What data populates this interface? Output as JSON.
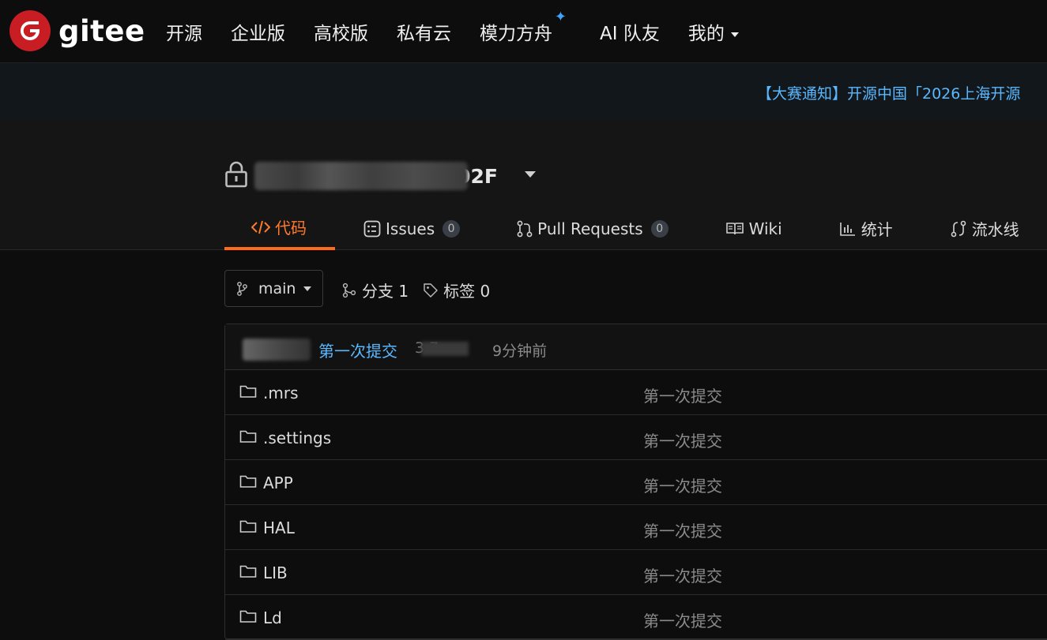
{
  "nav": {
    "logo_text": "gitee",
    "items": [
      "开源",
      "企业版",
      "高校版",
      "私有云",
      "模力方舟",
      "AI 队友",
      "我的"
    ]
  },
  "announcement": "【大赛通知】开源中国「2026上海开源",
  "repo": {
    "name_suffix": "02F",
    "tabs": [
      {
        "label": "代码"
      },
      {
        "label": "Issues",
        "count": "0"
      },
      {
        "label": "Pull Requests",
        "count": "0"
      },
      {
        "label": "Wiki"
      },
      {
        "label": "统计"
      },
      {
        "label": "流水线"
      }
    ]
  },
  "branch": {
    "current": "main",
    "branches_label": "分支 1",
    "tags_label": "标签 0"
  },
  "latest_commit": {
    "message": "第一次提交",
    "hash_tail": "3     7",
    "time": "9分钟前"
  },
  "files": [
    {
      "name": ".mrs",
      "message": "第一次提交"
    },
    {
      "name": ".settings",
      "message": "第一次提交"
    },
    {
      "name": "APP",
      "message": "第一次提交"
    },
    {
      "name": "HAL",
      "message": "第一次提交"
    },
    {
      "name": "LIB",
      "message": "第一次提交"
    },
    {
      "name": "Ld",
      "message": "第一次提交"
    }
  ],
  "colors": {
    "accent": "#ff6a1a",
    "link": "#5ab8ff",
    "brand": "#c71d23",
    "background": "#0d0d0d"
  }
}
